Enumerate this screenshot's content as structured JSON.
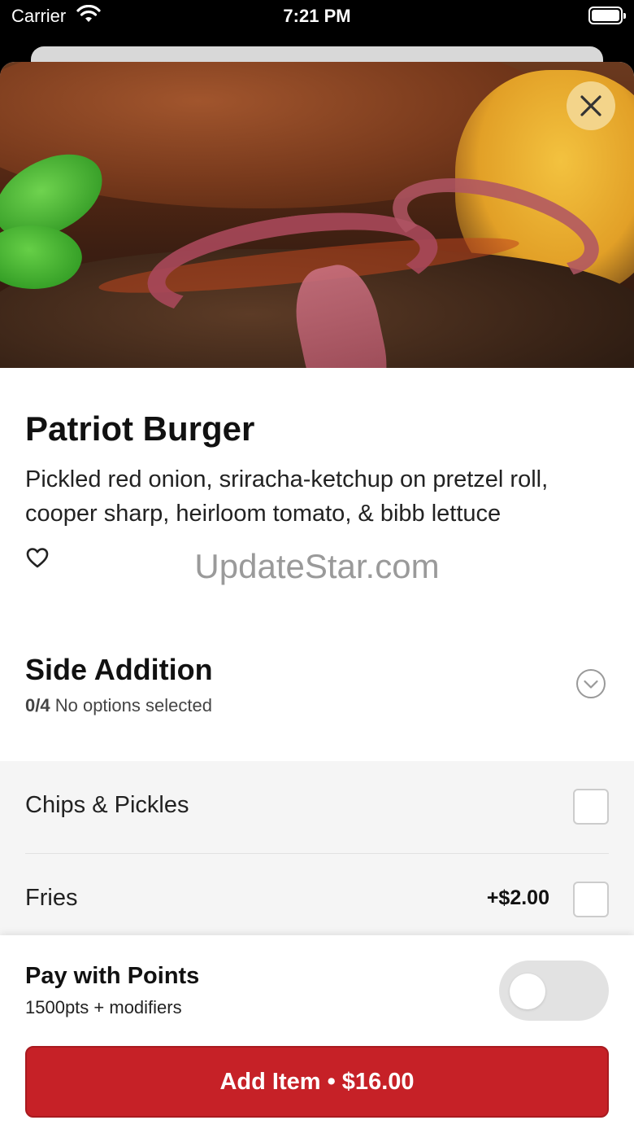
{
  "status_bar": {
    "carrier": "Carrier",
    "time": "7:21 PM"
  },
  "item": {
    "name": "Patriot Burger",
    "description": "Pickled red onion, sriracha-ketchup on pretzel roll, cooper sharp, heirloom tomato, & bibb lettuce"
  },
  "watermark": "UpdateStar.com",
  "section": {
    "title": "Side Addition",
    "count": "0/4",
    "status": "No options selected"
  },
  "options": [
    {
      "label": "Chips & Pickles",
      "price": ""
    },
    {
      "label": "Fries",
      "price": "+$2.00"
    }
  ],
  "points": {
    "title": "Pay with Points",
    "subtitle": "1500pts + modifiers",
    "enabled": false
  },
  "add_button": {
    "label": "Add Item • $16.00"
  },
  "colors": {
    "accent": "#c62127",
    "close_button": "#f3d48a",
    "toggle_off": "#e2e2e2"
  }
}
